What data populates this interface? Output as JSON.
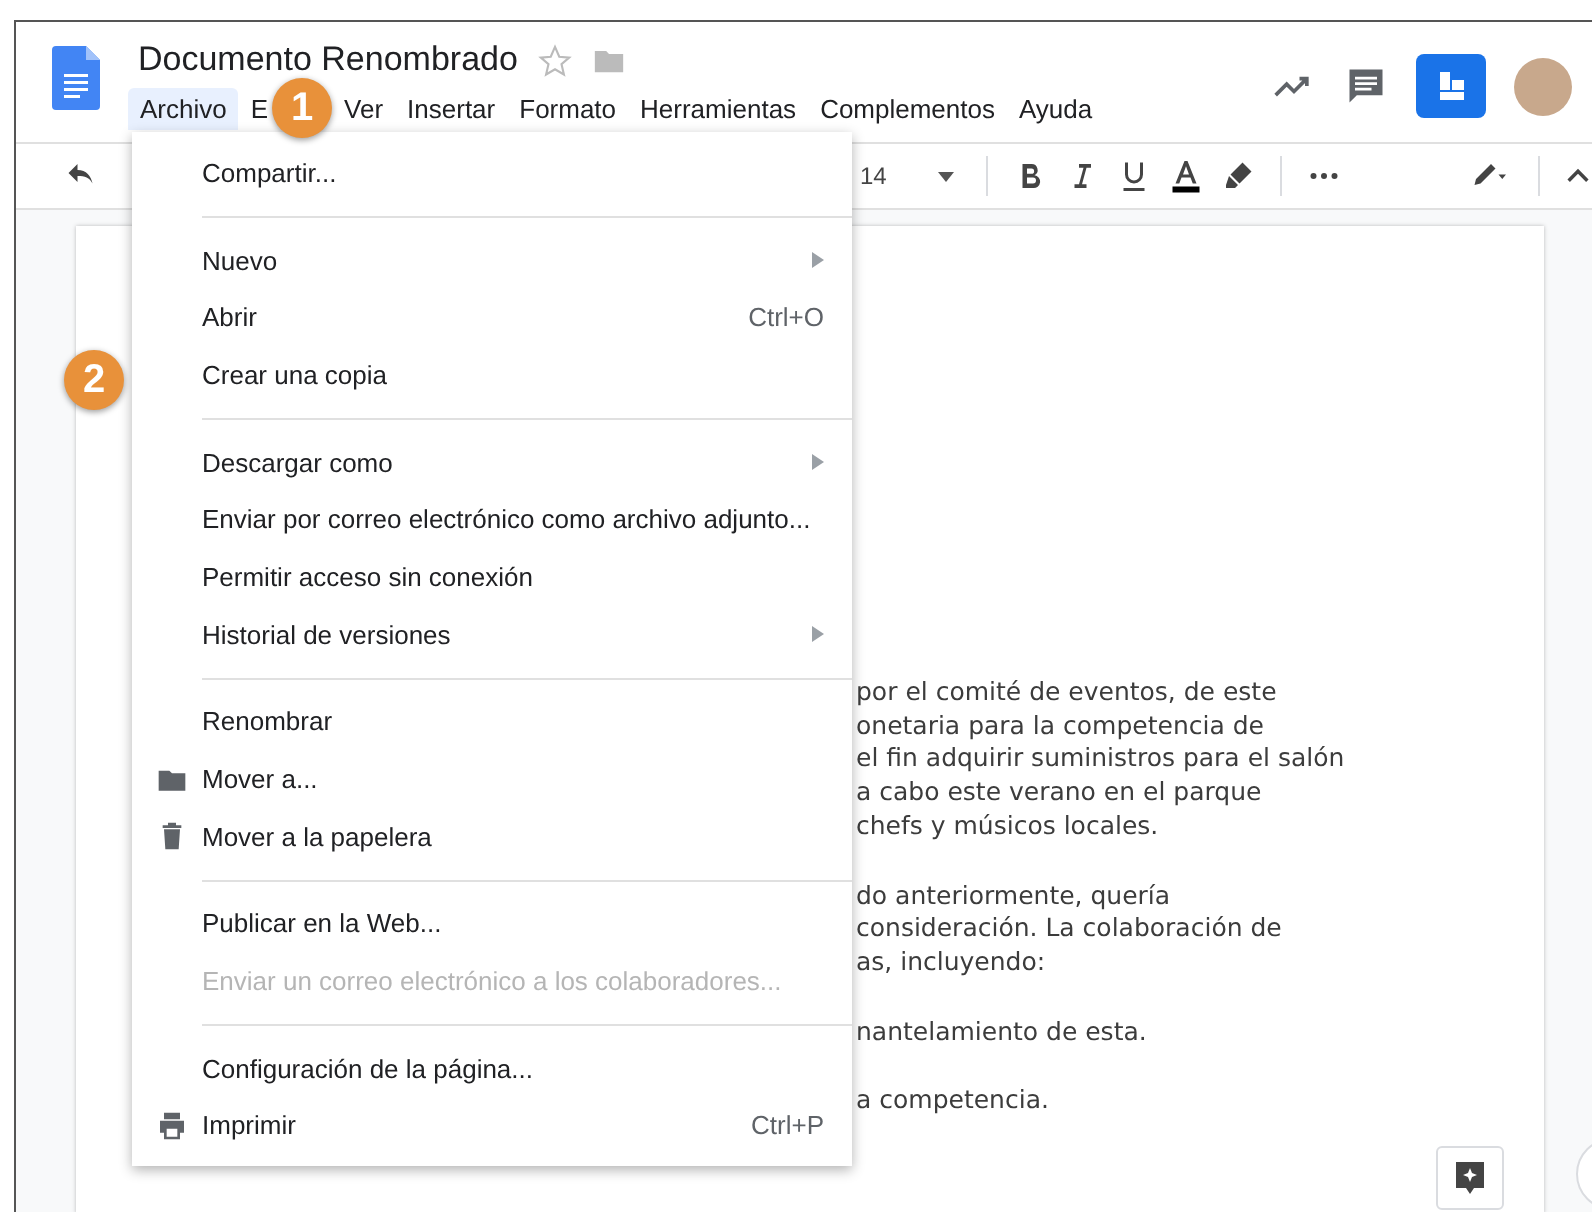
{
  "document": {
    "title": "Documento Renombrado",
    "starred": false
  },
  "menu_bar": [
    {
      "label": "Archivo",
      "selected": true
    },
    {
      "label": "E",
      "selected": false
    },
    {
      "label": "Ver",
      "selected": false
    },
    {
      "label": "Insertar",
      "selected": false
    },
    {
      "label": "Formato",
      "selected": false
    },
    {
      "label": "Herramientas",
      "selected": false
    },
    {
      "label": "Complementos",
      "selected": false
    },
    {
      "label": "Ayuda",
      "selected": false
    }
  ],
  "toolbar": {
    "font_size": "14"
  },
  "file_menu": [
    {
      "kind": "item",
      "label": "Compartir...",
      "disabled": false
    },
    {
      "kind": "separator"
    },
    {
      "kind": "item",
      "label": "Nuevo",
      "submenu": true,
      "disabled": false
    },
    {
      "kind": "item",
      "label": "Abrir",
      "shortcut": "Ctrl+O",
      "disabled": false
    },
    {
      "kind": "item",
      "label": "Crear una copia",
      "disabled": false
    },
    {
      "kind": "separator"
    },
    {
      "kind": "item",
      "label": "Descargar como",
      "submenu": true,
      "disabled": false
    },
    {
      "kind": "item",
      "label": "Enviar por correo electrónico como archivo adjunto...",
      "disabled": false
    },
    {
      "kind": "item",
      "label": "Permitir acceso sin conexión",
      "disabled": false
    },
    {
      "kind": "item",
      "label": "Historial de versiones",
      "submenu": true,
      "disabled": false
    },
    {
      "kind": "separator"
    },
    {
      "kind": "item",
      "label": "Renombrar",
      "disabled": false
    },
    {
      "kind": "folder",
      "label": "Mover a...",
      "disabled": false
    },
    {
      "kind": "trash",
      "label": "Mover a la papelera",
      "disabled": false
    },
    {
      "kind": "separator"
    },
    {
      "kind": "item",
      "label": "Publicar en la Web...",
      "disabled": false
    },
    {
      "kind": "item",
      "label": "Enviar un correo electrónico a los colaboradores...",
      "disabled": true
    },
    {
      "kind": "separator"
    },
    {
      "kind": "item",
      "label": "Configuración de la página...",
      "disabled": false
    },
    {
      "kind": "printer",
      "label": "Imprimir",
      "shortcut": "Ctrl+P",
      "disabled": false
    }
  ],
  "document_body": [
    {
      "lines": [
        "por el comité de eventos, de este",
        "onetaria para la competencia de",
        "el fin adquirir suministros para el salón",
        "a cabo este verano en el parque",
        "chefs y músicos locales."
      ]
    },
    {
      "lines": [
        "do anteriormente, quería",
        "consideración. La colaboración de",
        "as, incluyendo:"
      ]
    },
    {
      "lines": [
        "nantelamiento de esta."
      ]
    },
    {
      "lines": [
        "a competencia."
      ]
    }
  ],
  "callouts": [
    {
      "number": "1"
    },
    {
      "number": "2"
    }
  ]
}
